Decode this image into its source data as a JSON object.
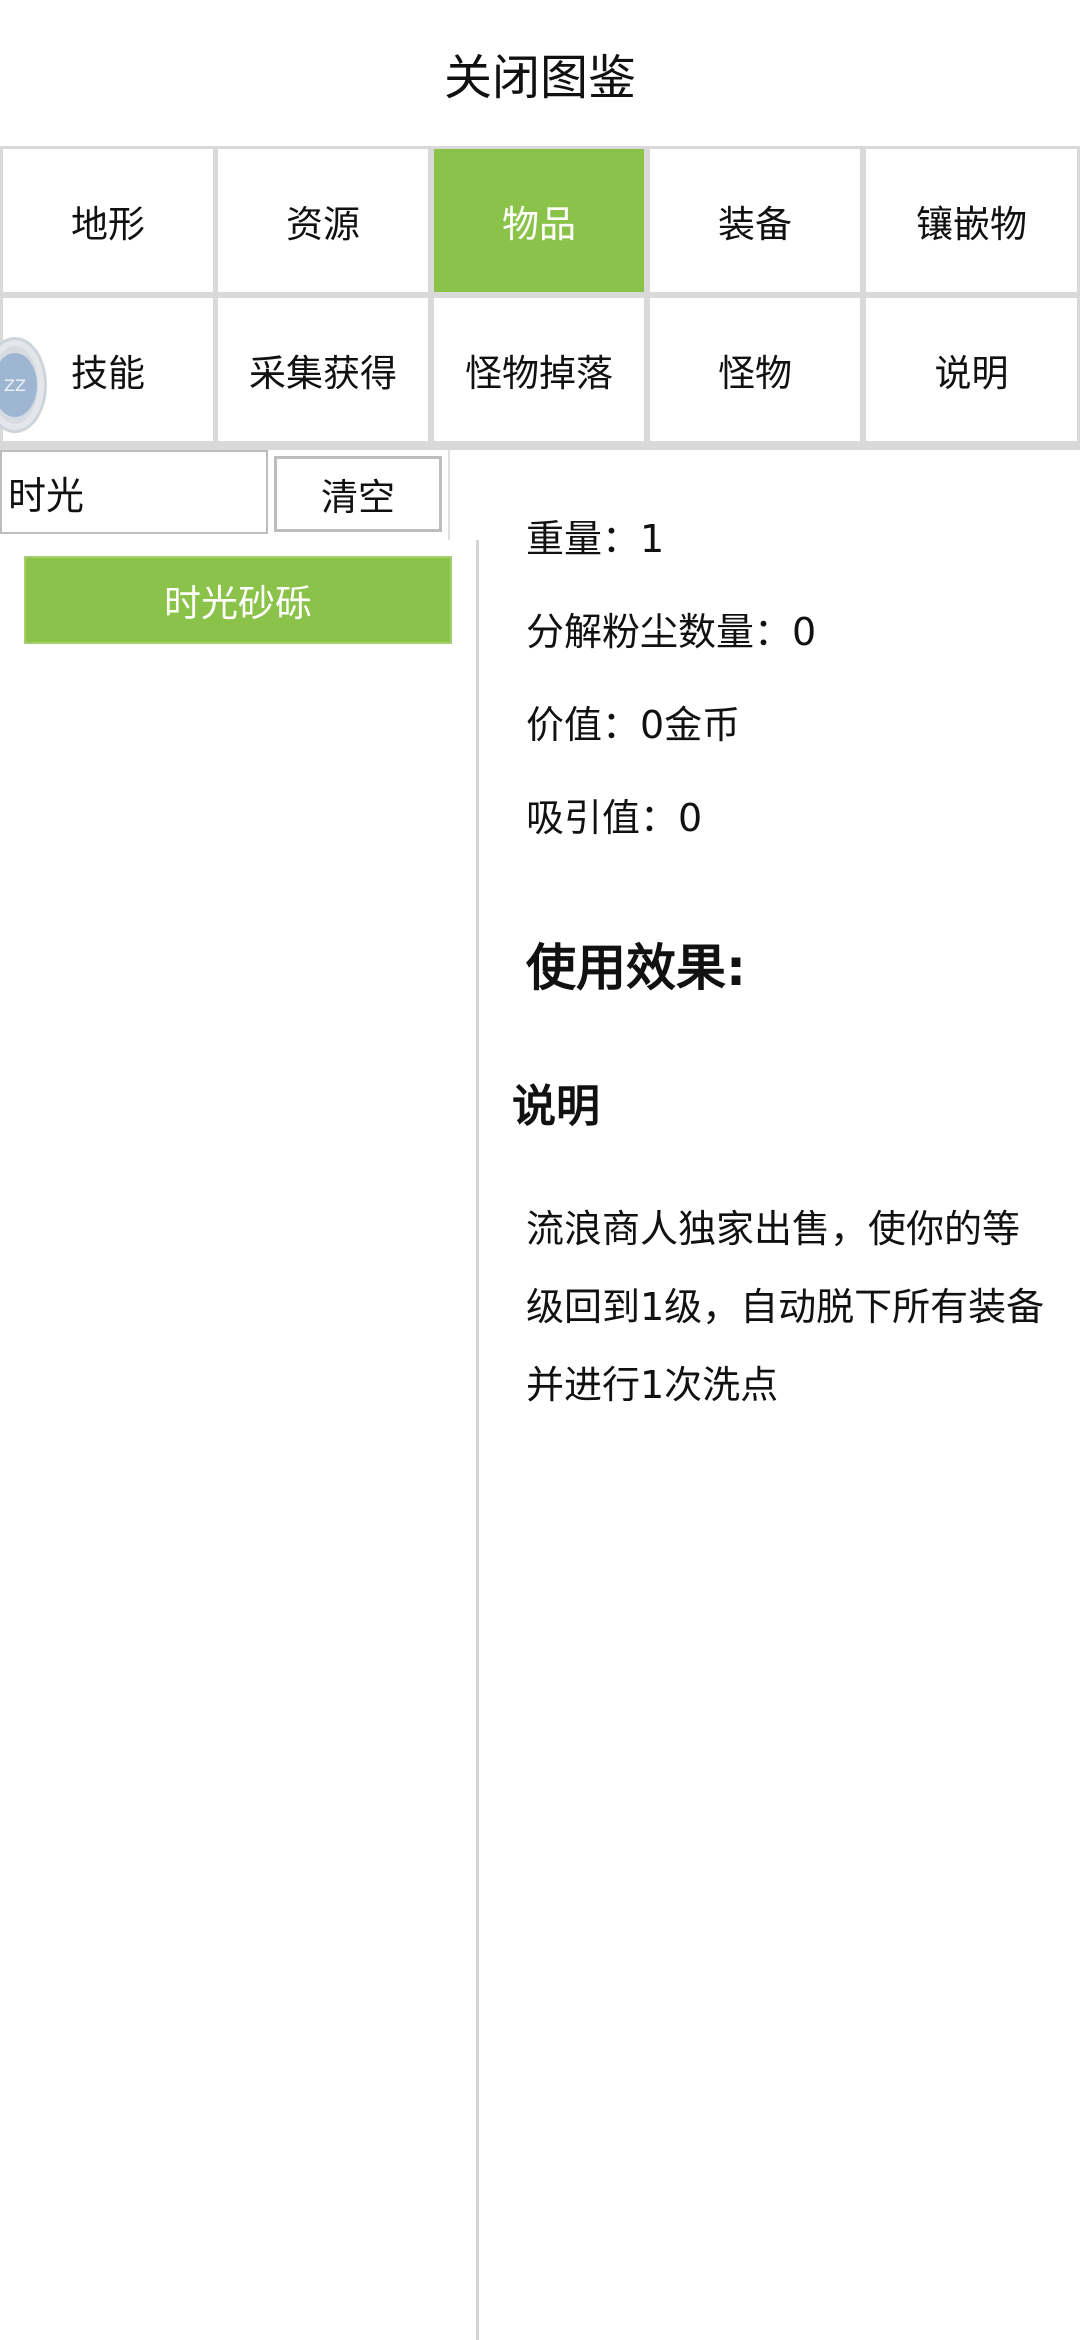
{
  "header": {
    "title": "关闭图鉴"
  },
  "categories": {
    "row1": [
      "地形",
      "资源",
      "物品",
      "装备",
      "镶嵌物"
    ],
    "row2": [
      "技能",
      "采集获得",
      "怪物掉落",
      "怪物",
      "说明"
    ],
    "active": "物品"
  },
  "avatar": {
    "text": "ZZ"
  },
  "search": {
    "value": "时光",
    "clear_label": "清空"
  },
  "results": [
    "时光砂砾"
  ],
  "detail": {
    "weight": "重量：1",
    "dust": "分解粉尘数量：0",
    "value": "价值：0金币",
    "attract": "吸引值：0",
    "effect_heading": "使用效果:",
    "desc_heading": "说明",
    "desc_text": "流浪商人独家出售，使你的等级回到1级，自动脱下所有装备并进行1次洗点"
  },
  "colors": {
    "accent": "#8bc34a",
    "border": "#d9d9d9"
  }
}
